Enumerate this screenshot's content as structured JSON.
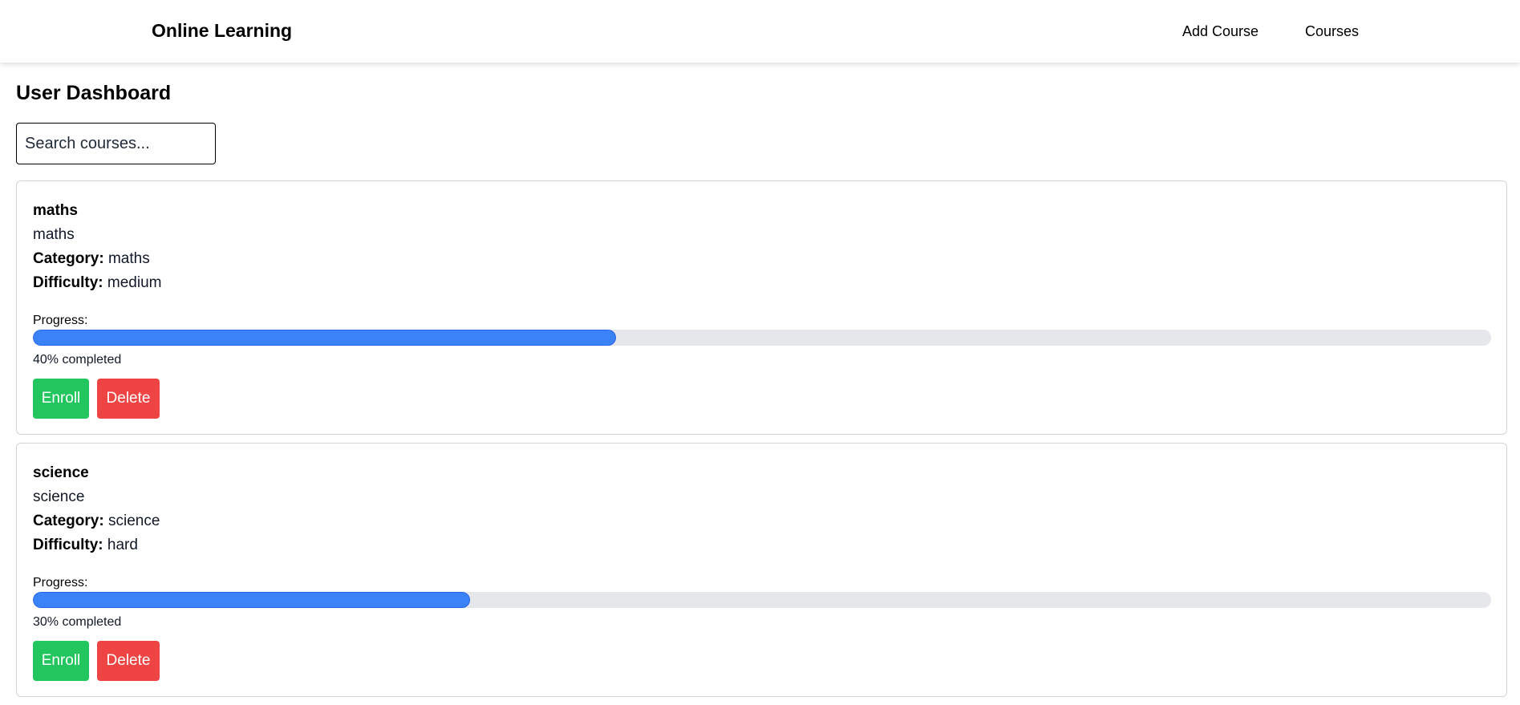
{
  "header": {
    "brand": "Online Learning",
    "nav": {
      "add_course": "Add Course",
      "courses": "Courses"
    }
  },
  "main": {
    "title": "User Dashboard",
    "search": {
      "placeholder": "Search courses...",
      "value": ""
    }
  },
  "labels": {
    "category": "Category:",
    "difficulty": "Difficulty:",
    "progress": "Progress:",
    "enroll": "Enroll",
    "delete": "Delete"
  },
  "courses": [
    {
      "title": "maths",
      "description": "maths",
      "category": "maths",
      "difficulty": "medium",
      "progress_percent": 40,
      "progress_text": "40% completed"
    },
    {
      "title": "science",
      "description": "science",
      "category": "science",
      "difficulty": "hard",
      "progress_percent": 30,
      "progress_text": "30% completed"
    }
  ],
  "colors": {
    "progress_fill": "#3b82f6",
    "progress_track": "#e5e7eb",
    "enroll_button": "#22c55e",
    "delete_button": "#ef4444"
  }
}
